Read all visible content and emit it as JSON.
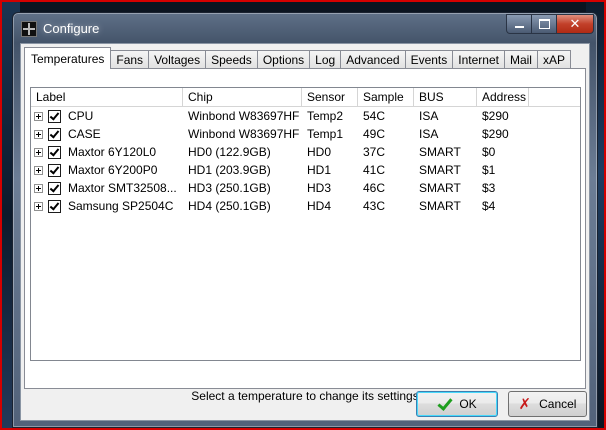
{
  "window": {
    "title": "Configure",
    "min_glyph": "",
    "close_glyph": "✕"
  },
  "tabs": [
    {
      "label": "Temperatures",
      "active": true
    },
    {
      "label": "Fans"
    },
    {
      "label": "Voltages"
    },
    {
      "label": "Speeds"
    },
    {
      "label": "Options"
    },
    {
      "label": "Log"
    },
    {
      "label": "Advanced"
    },
    {
      "label": "Events"
    },
    {
      "label": "Internet"
    },
    {
      "label": "Mail"
    },
    {
      "label": "xAP"
    }
  ],
  "table": {
    "columns": [
      "Label",
      "Chip",
      "Sensor",
      "Sample",
      "BUS",
      "Address"
    ],
    "rows": [
      {
        "label": "CPU",
        "chip": "Winbond W83697HF",
        "sensor": "Temp2",
        "sample": "54C",
        "bus": "ISA",
        "address": "$290",
        "checked": true
      },
      {
        "label": "CASE",
        "chip": "Winbond W83697HF",
        "sensor": "Temp1",
        "sample": "49C",
        "bus": "ISA",
        "address": "$290",
        "checked": true
      },
      {
        "label": "Maxtor 6Y120L0",
        "chip": "HD0 (122.9GB)",
        "sensor": "HD0",
        "sample": "37C",
        "bus": "SMART",
        "address": "$0",
        "checked": true
      },
      {
        "label": "Maxtor 6Y200P0",
        "chip": "HD1 (203.9GB)",
        "sensor": "HD1",
        "sample": "41C",
        "bus": "SMART",
        "address": "$1",
        "checked": true
      },
      {
        "label": "Maxtor SMT32508...",
        "chip": "HD3 (250.1GB)",
        "sensor": "HD3",
        "sample": "46C",
        "bus": "SMART",
        "address": "$3",
        "checked": true
      },
      {
        "label": "Samsung SP2504C",
        "chip": "HD4 (250.1GB)",
        "sensor": "HD4",
        "sample": "43C",
        "bus": "SMART",
        "address": "$4",
        "checked": true
      }
    ]
  },
  "status_message": "Select a temperature to change its settings",
  "buttons": {
    "ok": "OK",
    "cancel": "Cancel"
  },
  "icons": {
    "app": "app-crosshair-icon",
    "ok": "checkmark-icon",
    "cancel": "cross-icon"
  },
  "colors": {
    "titlebar": "#44546a",
    "close_button": "#c2402a",
    "ok_check": "#1e9e1e",
    "cancel_x": "#c71818",
    "frame_accent": "#d40000"
  }
}
